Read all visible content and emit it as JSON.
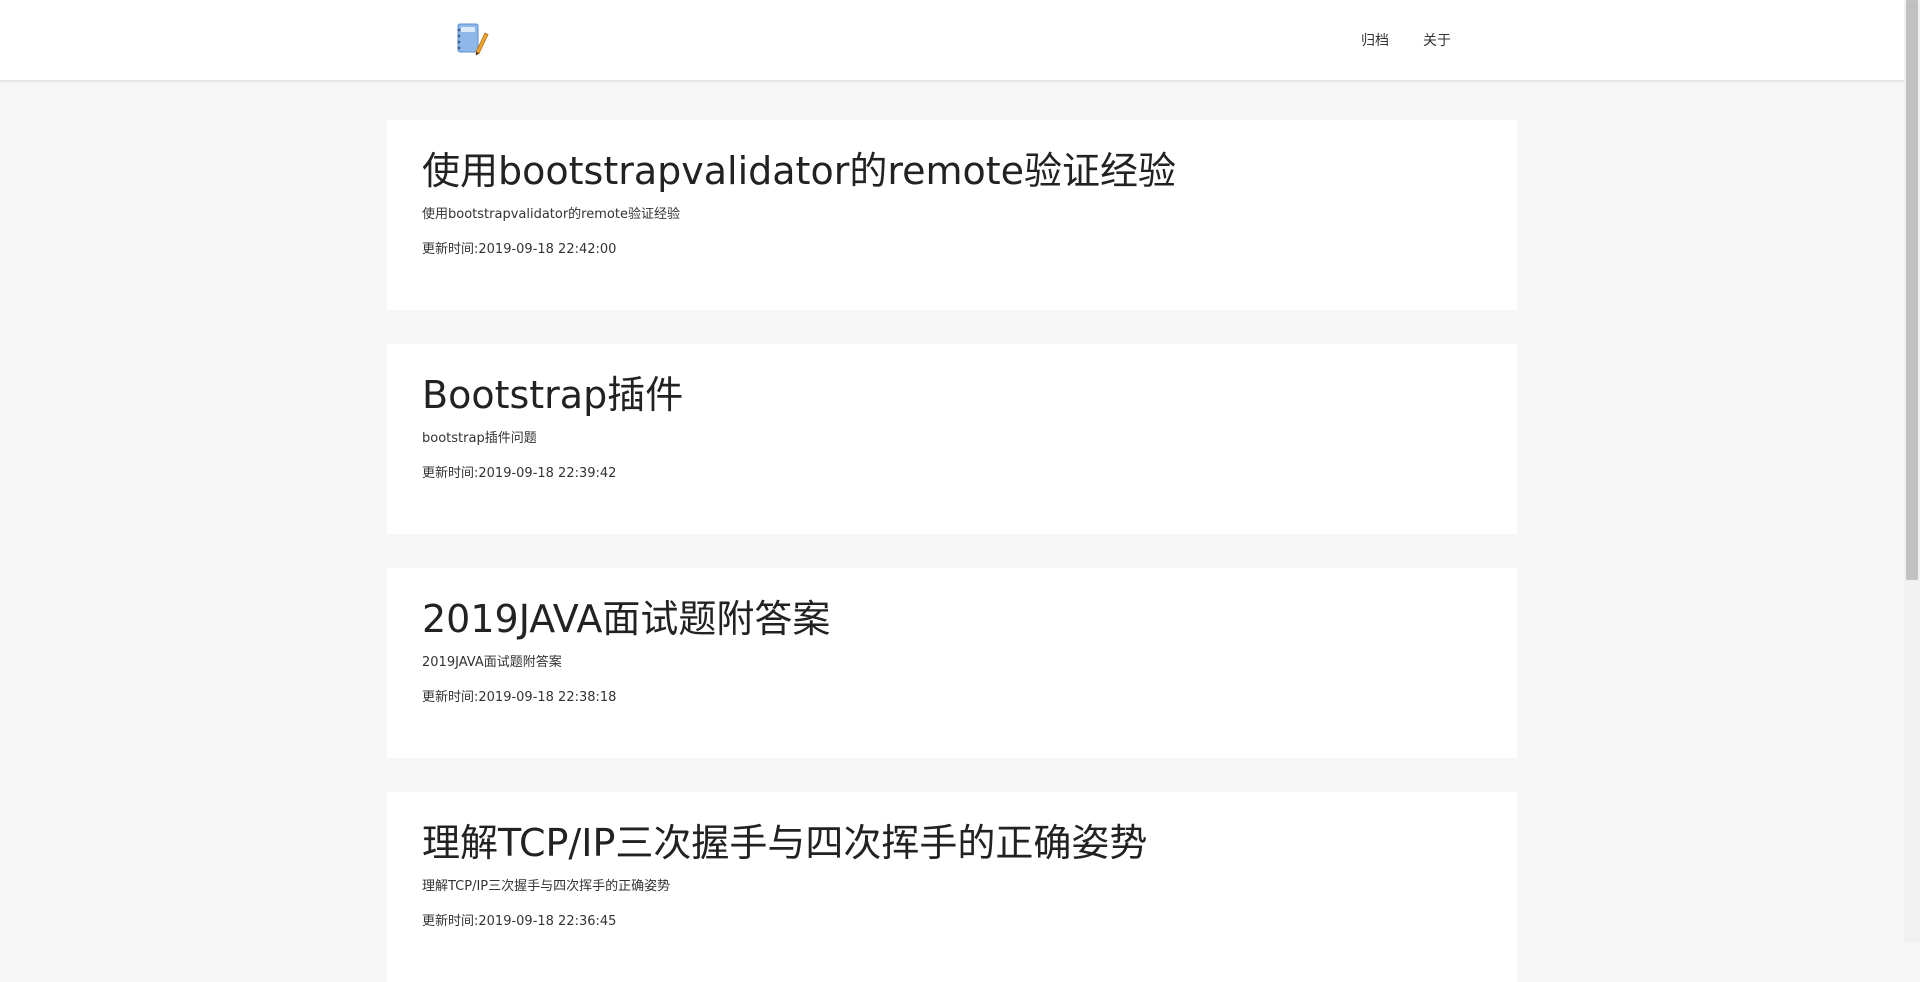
{
  "header": {
    "logo_icon": "notebook-pencil-icon",
    "nav": [
      {
        "label": "归档"
      },
      {
        "label": "关于"
      }
    ]
  },
  "posts": [
    {
      "title": "使用bootstrapvalidator的remote验证经验",
      "summary": "使用bootstrapvalidator的remote验证经验",
      "updated": "更新时间:2019-09-18 22:42:00"
    },
    {
      "title": "Bootstrap插件",
      "summary": "bootstrap插件问题",
      "updated": "更新时间:2019-09-18 22:39:42"
    },
    {
      "title": "2019JAVA面试题附答案",
      "summary": "2019JAVA面试题附答案",
      "updated": "更新时间:2019-09-18 22:38:18"
    },
    {
      "title": "理解TCP/IP三次握手与四次挥手的正确姿势",
      "summary": "理解TCP/IP三次握手与四次挥手的正确姿势",
      "updated": "更新时间:2019-09-18 22:36:45"
    }
  ]
}
